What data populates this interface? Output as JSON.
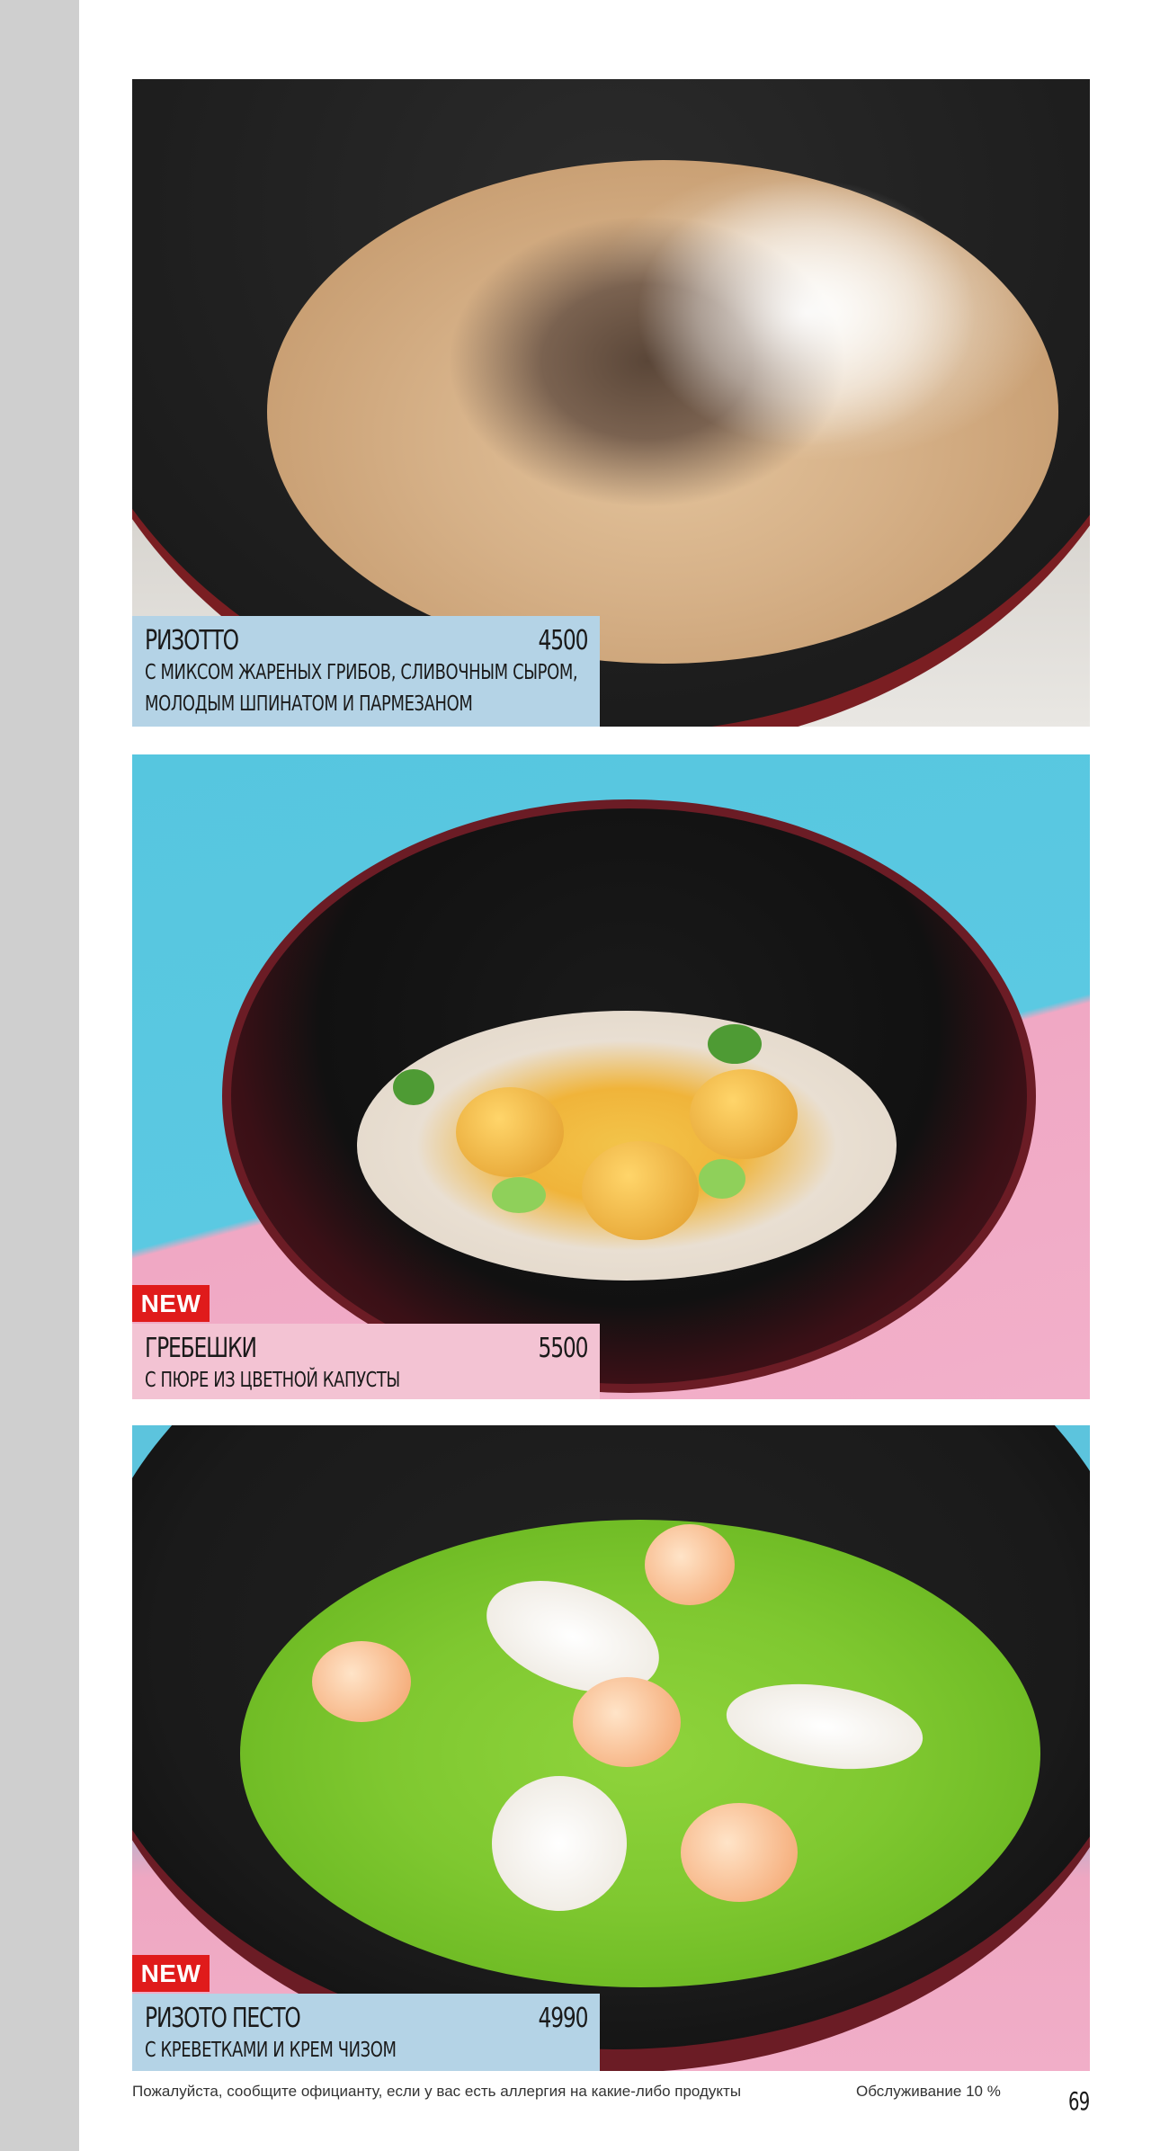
{
  "menu_items": [
    {
      "name": "РИЗОТТО",
      "price": "4500",
      "description_lines": [
        "С МИКСОМ ЖАРЕНЫХ ГРИБОВ, СЛИВОЧНЫМ СЫРОМ,",
        "МОЛОДЫМ ШПИНАТОМ  И ПАРМЕЗАНОМ"
      ],
      "label_color": "#b4d3e6"
    },
    {
      "badge": "NEW",
      "name": "ГРЕБЕШКИ",
      "price": "5500",
      "description_lines": [
        "С ПЮРЕ ИЗ ЦВЕТНОЙ КАПУСТЫ"
      ],
      "label_color": "#f3c3d3"
    },
    {
      "badge": "NEW",
      "name": "РИЗОТО ПЕСТО",
      "price": "4990",
      "description_lines": [
        "С КРЕВЕТКАМИ И КРЕМ ЧИЗОМ"
      ],
      "label_color": "#b4d3e6"
    }
  ],
  "footer": {
    "allergy_note": "Пожалуйста, сообщите официанту, если у вас есть аллергия на какие-либо продукты",
    "service_charge": "Обслуживание 10 %"
  },
  "page_number": "69",
  "colors": {
    "badge_red": "#e01b1b",
    "side_strip": "#cfcfcf"
  }
}
